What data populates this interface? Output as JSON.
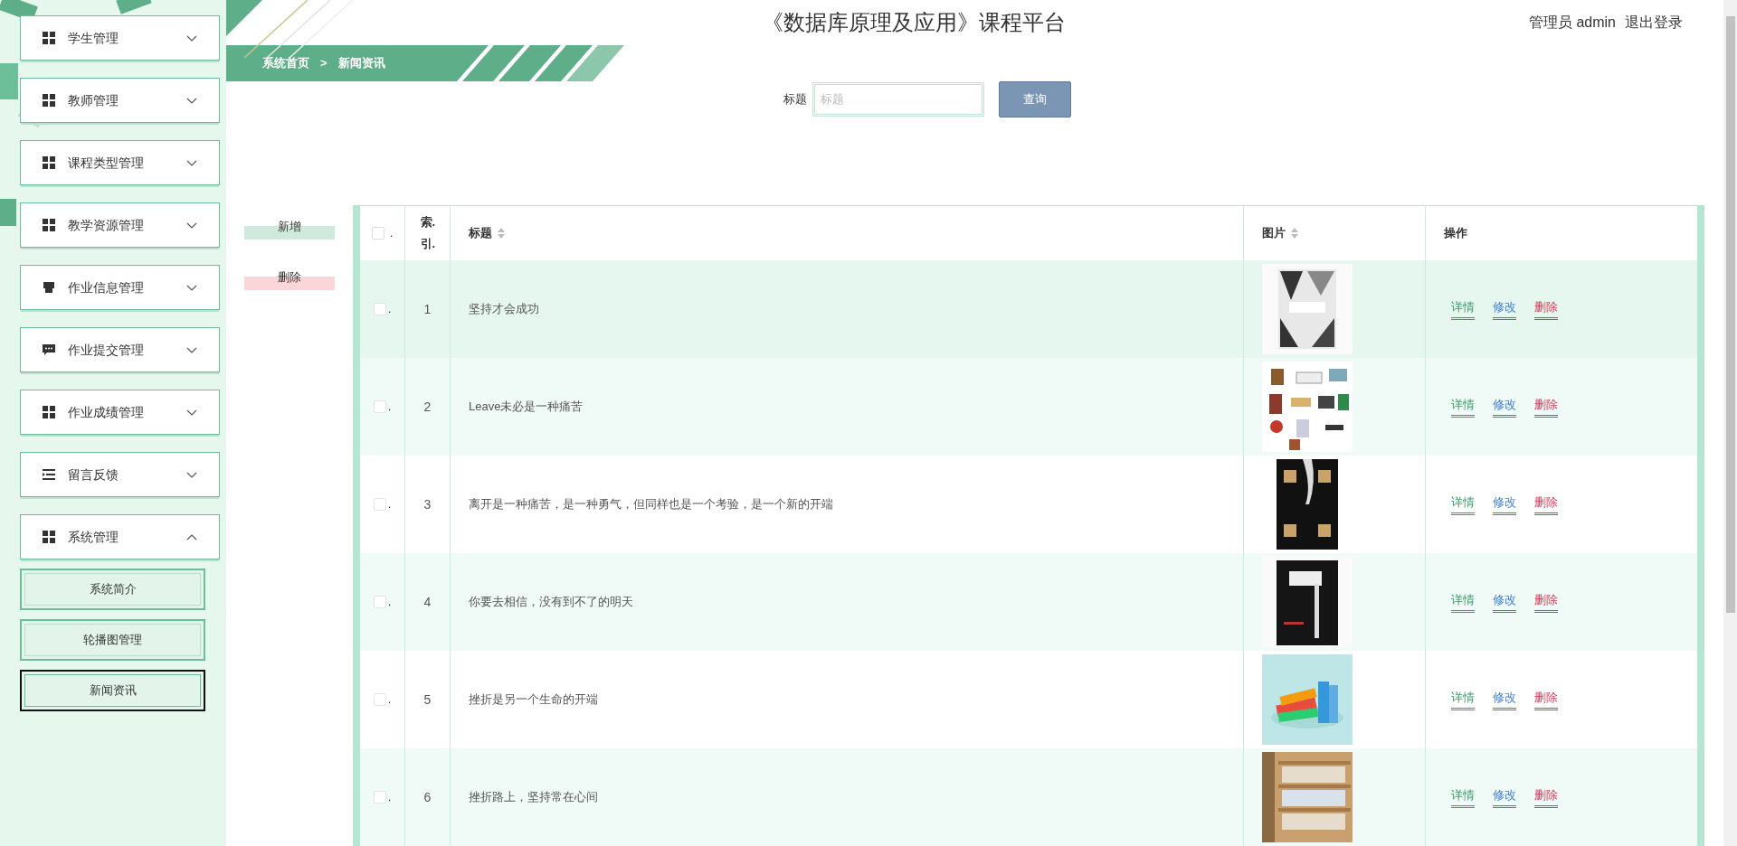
{
  "header": {
    "title": "《数据库原理及应用》课程平台",
    "user": "管理员 admin",
    "logout": "退出登录"
  },
  "sidebar": {
    "items": [
      {
        "label": "学生管理",
        "kind": "grid",
        "expanded": false
      },
      {
        "label": "教师管理",
        "kind": "grid",
        "expanded": false
      },
      {
        "label": "课程类型管理",
        "kind": "grid",
        "expanded": false
      },
      {
        "label": "教学资源管理",
        "kind": "grid",
        "expanded": false
      },
      {
        "label": "作业信息管理",
        "kind": "store",
        "expanded": false
      },
      {
        "label": "作业提交管理",
        "kind": "chat",
        "expanded": false
      },
      {
        "label": "作业成绩管理",
        "kind": "grid",
        "expanded": false
      },
      {
        "label": "留言反馈",
        "kind": "list",
        "expanded": false
      },
      {
        "label": "系统管理",
        "kind": "grid",
        "expanded": true,
        "children": [
          {
            "label": "系统简介",
            "selected": false
          },
          {
            "label": "轮播图管理",
            "selected": false
          },
          {
            "label": "新闻资讯",
            "selected": true
          }
        ]
      }
    ]
  },
  "breadcrumb": [
    "系统首页",
    ">",
    "新闻资讯"
  ],
  "search": {
    "label": "标题",
    "placeholder": "标题",
    "button": "查询"
  },
  "actions": [
    {
      "label": "新增",
      "kind": "add"
    },
    {
      "label": "删除",
      "kind": "delete"
    }
  ],
  "table": {
    "columns": [
      {
        "label": ".",
        "kind": "check",
        "sortable": false,
        "checked": false
      },
      {
        "label": "索.引.",
        "kind": "index",
        "sortable": false
      },
      {
        "label": "标题",
        "kind": "title",
        "sortable": true
      },
      {
        "label": "图片",
        "kind": "picture",
        "sortable": true
      },
      {
        "label": "操作",
        "kind": "actions",
        "sortable": false
      }
    ],
    "rows": [
      {
        "checked": false,
        "mark": ".",
        "index": "1",
        "title": "坚持才会成功",
        "actions": [
          {
            "label": "详情",
            "kind": "detail"
          },
          {
            "label": "修改",
            "kind": "edit"
          },
          {
            "label": "删除",
            "kind": "delete"
          }
        ]
      },
      {
        "checked": false,
        "mark": ".",
        "index": "2",
        "title": "Leave未必是一种痛苦",
        "actions": [
          {
            "label": "详情",
            "kind": "detail"
          },
          {
            "label": "修改",
            "kind": "edit"
          },
          {
            "label": "删除",
            "kind": "delete"
          }
        ]
      },
      {
        "checked": false,
        "mark": ".",
        "index": "3",
        "title": "离开是一种痛苦，是一种勇气，但同样也是一个考验，是一个新的开端",
        "actions": [
          {
            "label": "详情",
            "kind": "detail"
          },
          {
            "label": "修改",
            "kind": "edit"
          },
          {
            "label": "删除",
            "kind": "delete"
          }
        ]
      },
      {
        "checked": false,
        "mark": ".",
        "index": "4",
        "title": "你要去相信，没有到不了的明天",
        "actions": [
          {
            "label": "详情",
            "kind": "detail"
          },
          {
            "label": "修改",
            "kind": "edit"
          },
          {
            "label": "删除",
            "kind": "delete"
          }
        ]
      },
      {
        "checked": false,
        "mark": ".",
        "index": "5",
        "title": "挫折是另一个生命的开端",
        "actions": [
          {
            "label": "详情",
            "kind": "detail"
          },
          {
            "label": "修改",
            "kind": "edit"
          },
          {
            "label": "删除",
            "kind": "delete"
          }
        ]
      },
      {
        "checked": false,
        "mark": ".",
        "index": "6",
        "title": "挫折路上，坚持常在心间",
        "actions": [
          {
            "label": "详情",
            "kind": "detail"
          },
          {
            "label": "修改",
            "kind": "edit"
          },
          {
            "label": "删除",
            "kind": "delete"
          }
        ]
      }
    ]
  }
}
